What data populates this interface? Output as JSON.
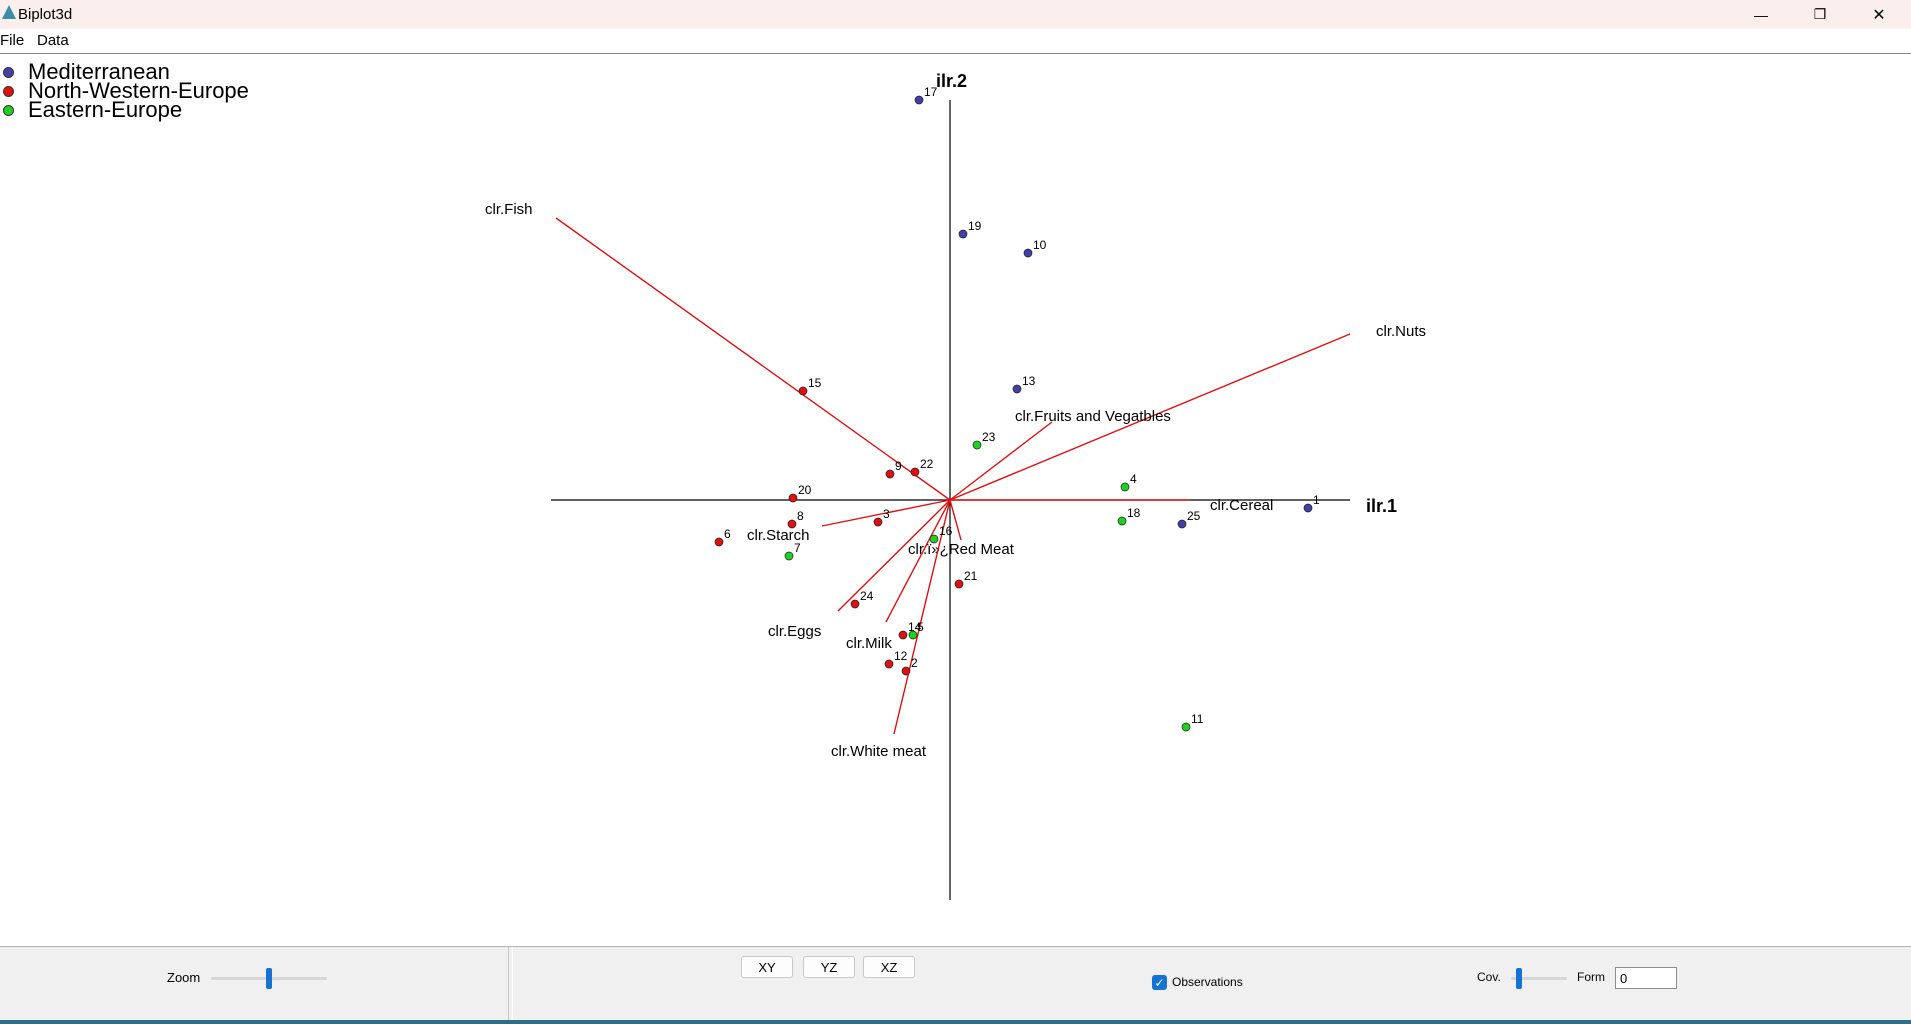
{
  "window": {
    "title": "Biplot3d",
    "controls": {
      "minimize": "—",
      "restore": "❐",
      "close": "✕"
    }
  },
  "menu": [
    "File",
    "Data"
  ],
  "legend": [
    {
      "label": "Mediterranean",
      "color": "#4040a8"
    },
    {
      "label": "North-Western-Europe",
      "color": "#e01010"
    },
    {
      "label": "Eastern-Europe",
      "color": "#20d020"
    }
  ],
  "axes": {
    "x_label": "ilr.1",
    "y_label": "ilr.2"
  },
  "variables": [
    {
      "label": "clr.Fish"
    },
    {
      "label": "clr.Nuts"
    },
    {
      "label": "clr.Fruits and Vegatbles"
    },
    {
      "label": "clr.Cereal"
    },
    {
      "label": "clr.Starch"
    },
    {
      "label": "clr.ï»¿Red Meat"
    },
    {
      "label": "clr.Eggs"
    },
    {
      "label": "clr.Milk"
    },
    {
      "label": "clr.White meat"
    }
  ],
  "observations": [
    {
      "id": "17",
      "group": 0
    },
    {
      "id": "19",
      "group": 0
    },
    {
      "id": "10",
      "group": 0
    },
    {
      "id": "13",
      "group": 0
    },
    {
      "id": "1",
      "group": 0
    },
    {
      "id": "25",
      "group": 0
    },
    {
      "id": "15",
      "group": 1
    },
    {
      "id": "9",
      "group": 1
    },
    {
      "id": "22",
      "group": 1
    },
    {
      "id": "20",
      "group": 1
    },
    {
      "id": "8",
      "group": 1
    },
    {
      "id": "3",
      "group": 1
    },
    {
      "id": "6",
      "group": 1
    },
    {
      "id": "21",
      "group": 1
    },
    {
      "id": "24",
      "group": 1
    },
    {
      "id": "14",
      "group": 1
    },
    {
      "id": "12",
      "group": 1
    },
    {
      "id": "2",
      "group": 1
    },
    {
      "id": "23",
      "group": 2
    },
    {
      "id": "4",
      "group": 2
    },
    {
      "id": "18",
      "group": 2
    },
    {
      "id": "16",
      "group": 2
    },
    {
      "id": "7",
      "group": 2
    },
    {
      "id": "5",
      "group": 2
    },
    {
      "id": "11",
      "group": 2
    }
  ],
  "controls": {
    "zoom_label": "Zoom",
    "zoom_value": 0.5,
    "view_buttons": [
      "XY",
      "YZ",
      "XZ"
    ],
    "observations_label": "Observations",
    "observations_checked": true,
    "cov_label": "Cov.",
    "cov_value": 0.1,
    "form_label": "Form",
    "form_value": "0"
  }
}
